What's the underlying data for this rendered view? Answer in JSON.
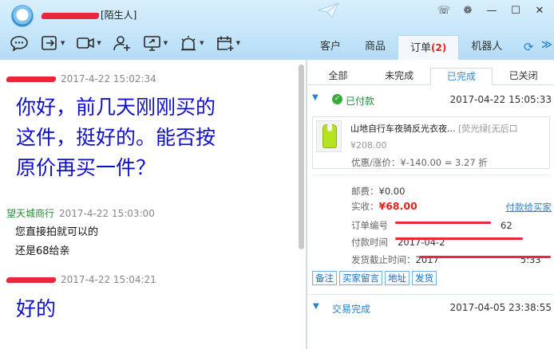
{
  "window": {
    "title_suffix": "[陌生人]"
  },
  "toolbar": {
    "items": [
      "chat-bubble",
      "transfer",
      "video",
      "add-contact",
      "share-screen",
      "alarm",
      "calendar-plus"
    ]
  },
  "top_tabs": [
    {
      "label": "客户",
      "badge": ""
    },
    {
      "label": "商品",
      "badge": ""
    },
    {
      "label": "订单",
      "badge": "(2)"
    },
    {
      "label": "机器人",
      "badge": ""
    }
  ],
  "chat": {
    "messages": [
      {
        "sender": "",
        "sender_color": "red",
        "time": "2017-4-22 15:02:34",
        "lines": [
          "你好，前几天刚刚买的",
          "这件，挺好的。能否按",
          "原价再买一件？"
        ],
        "style": "big"
      },
      {
        "sender": "望天城商行",
        "sender_color": "green",
        "time": "2017-4-22 15:03:00",
        "lines": [
          "您直接拍就可以的",
          "还是68给亲"
        ],
        "style": "small"
      },
      {
        "sender": "",
        "sender_color": "red",
        "time": "2017-4-22 15:04:21",
        "lines": [
          "好的"
        ],
        "style": "big"
      }
    ]
  },
  "orders": {
    "sub_tabs": [
      "全部",
      "未完成",
      "已完成",
      "已关闭"
    ],
    "active_sub_tab": 2,
    "order1": {
      "status": "已付款",
      "time": "2017-04-22 15:05:33",
      "product_title": "山地自行车夜骑反光衣夜...",
      "product_variant": "[荧光绿[无后口",
      "product_price": "¥208.00",
      "discount": "优惠/涨价：¥-140.00 = 3.27 折",
      "postage_label": "邮费：",
      "postage_value": "¥0.00",
      "received_label": "实收：",
      "received_value": "¥68.00",
      "pay_link": "付款给买家",
      "order_no_label": "订单编号",
      "order_no_tail": "62",
      "pay_time_label": "付款时间",
      "pay_time_value": "2017-04-2",
      "ship_deadline_label": "发货截止时间：",
      "ship_deadline_value": "2017",
      "ship_deadline_tail": "5:33",
      "actions": [
        "备注",
        "买家留言",
        "地址",
        "发货"
      ]
    },
    "order2": {
      "status": "交易完成",
      "time": "2017-04-05 23:38:55"
    }
  },
  "colors": {
    "accent": "#2a7fd0",
    "price_red": "#e2231a",
    "paid_green": "#3aab3a",
    "chat_blue": "#1010c8"
  }
}
